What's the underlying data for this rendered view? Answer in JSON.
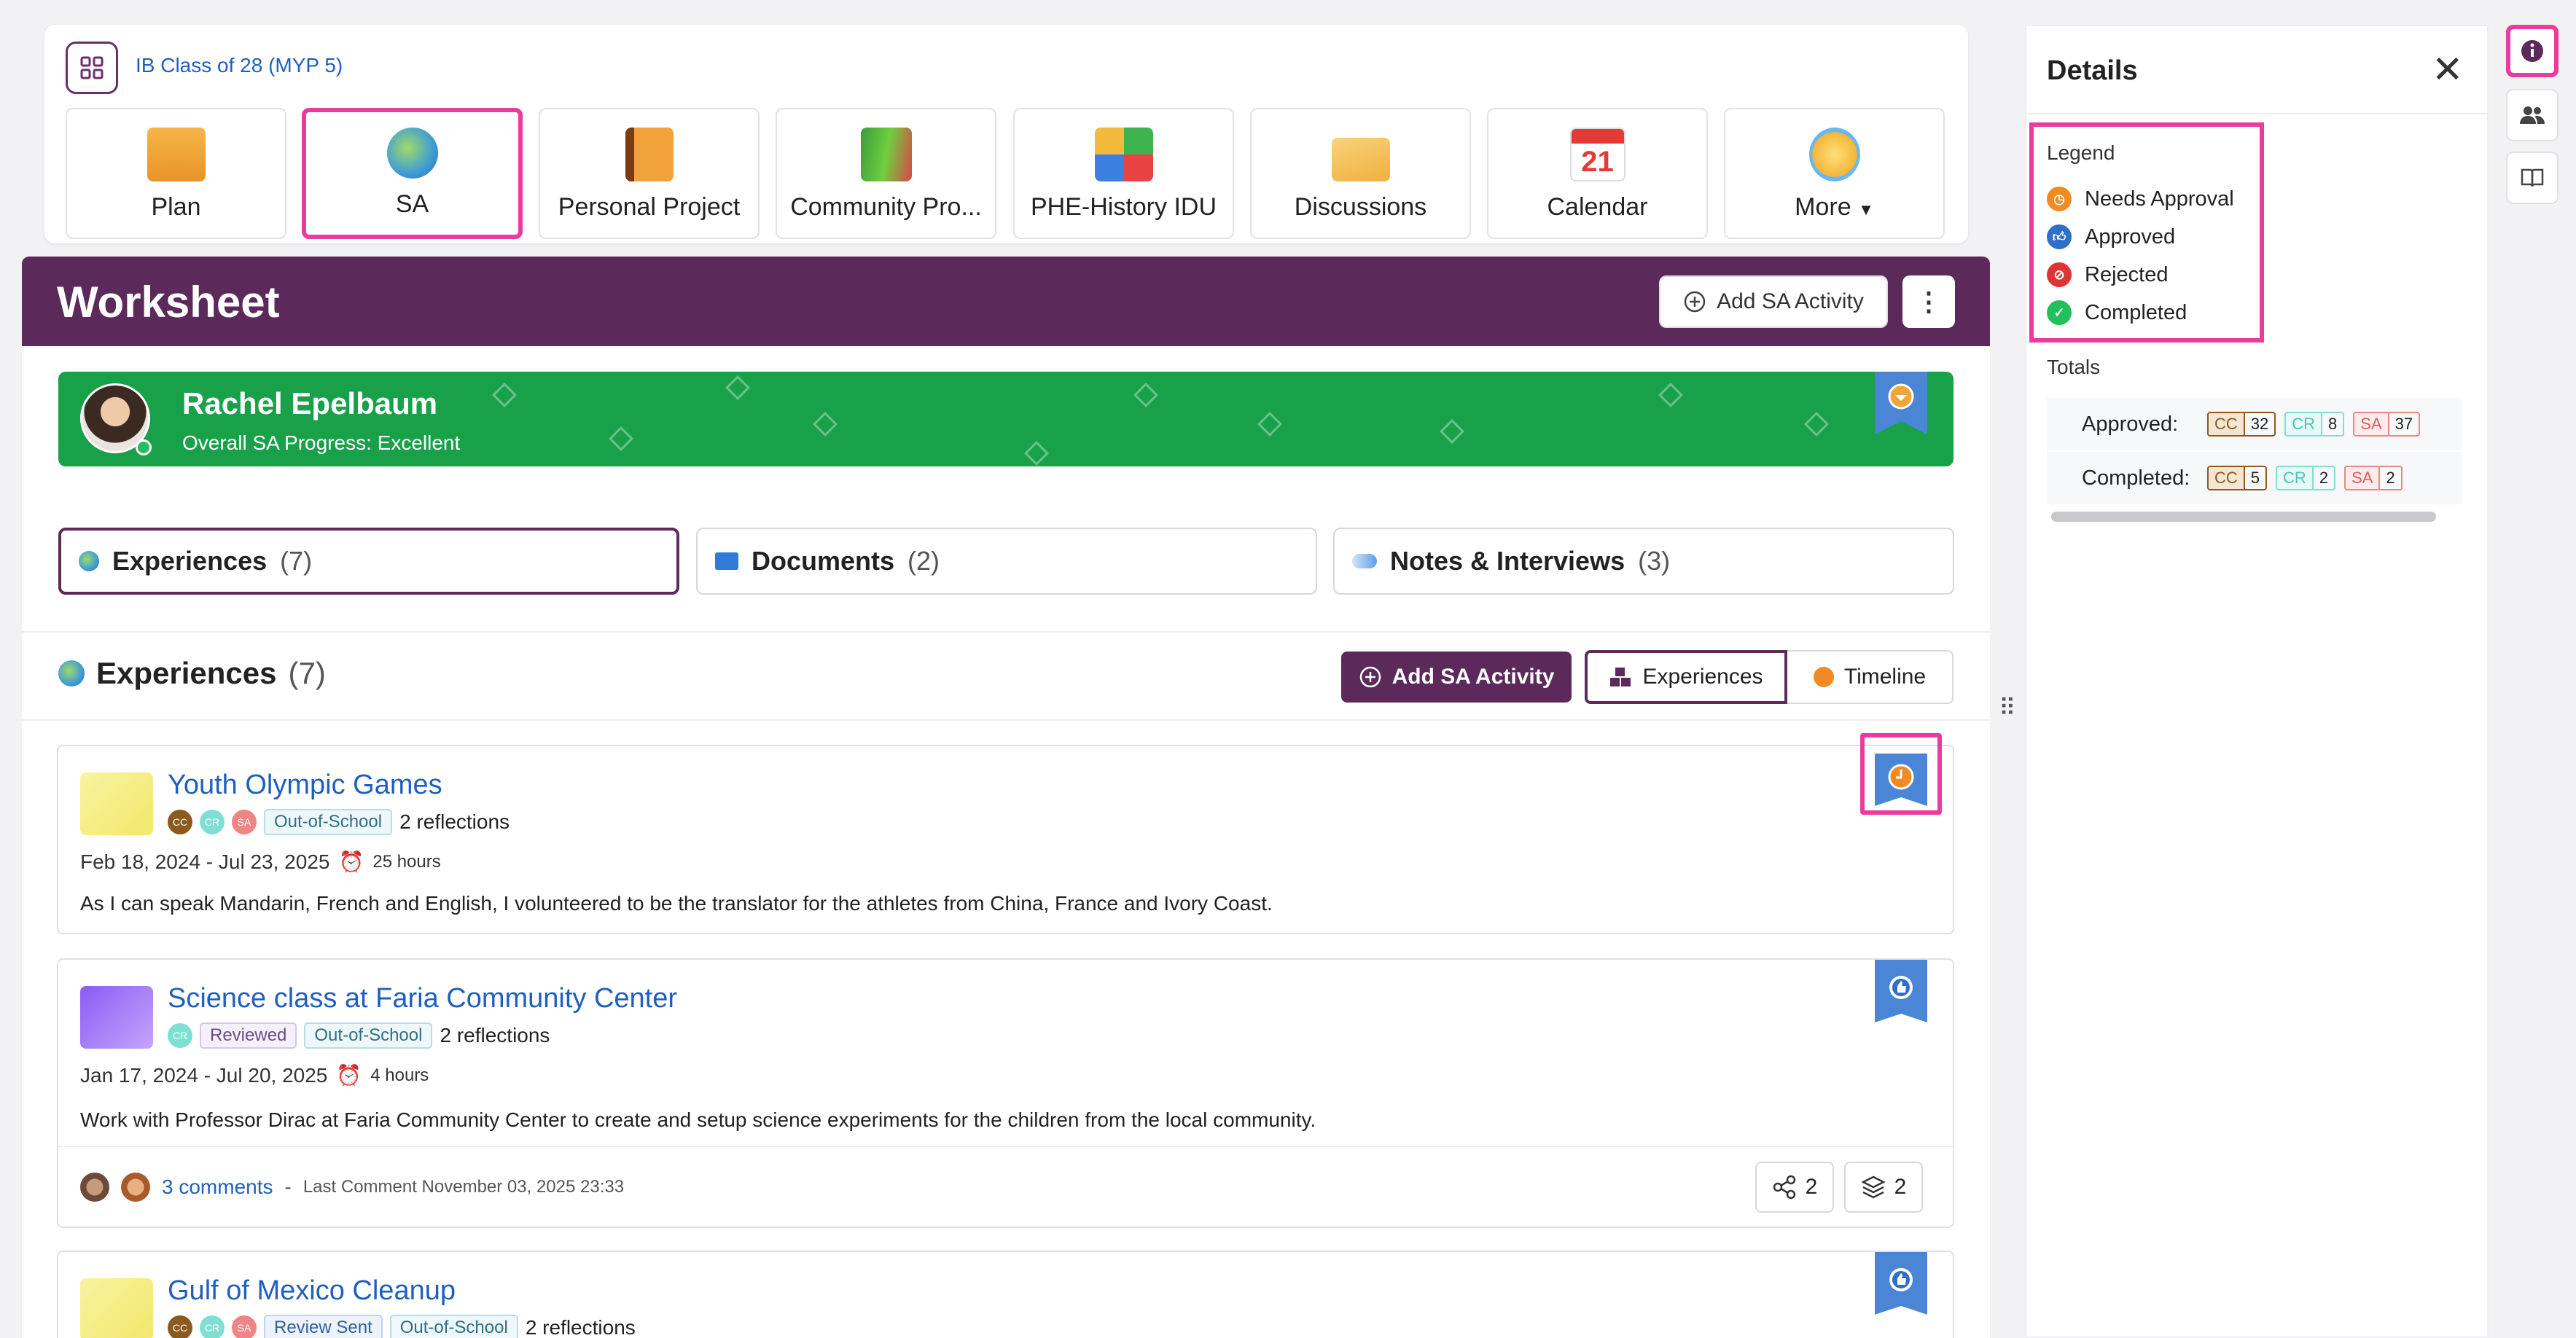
{
  "header": {
    "class_link": "IB Class of 28 (MYP 5)",
    "nav_tiles": [
      {
        "label": "Plan",
        "icon": "plan-icon",
        "selected": false
      },
      {
        "label": "SA",
        "icon": "globe-icon",
        "selected": true
      },
      {
        "label": "Personal Project",
        "icon": "notebook-icon",
        "selected": false
      },
      {
        "label": "Community Pro...",
        "icon": "books-icon",
        "selected": false
      },
      {
        "label": "PHE-History IDU",
        "icon": "puzzle-icon",
        "selected": false
      },
      {
        "label": "Discussions",
        "icon": "envelope-icon",
        "selected": false
      },
      {
        "label": "Calendar",
        "icon": "calendar-icon",
        "selected": false,
        "calendar_day": "21"
      },
      {
        "label": "More",
        "icon": "lightbulb-icon",
        "selected": false
      }
    ]
  },
  "worksheet": {
    "title": "Worksheet",
    "add_button": "Add SA Activity"
  },
  "student": {
    "name": "Rachel Epelbaum",
    "progress": "Overall SA Progress: Excellent",
    "status_color": "#19a14a"
  },
  "tabs": [
    {
      "label": "Experiences",
      "count": "(7)",
      "selected": true
    },
    {
      "label": "Documents",
      "count": "(2)",
      "selected": false
    },
    {
      "label": "Notes & Interviews",
      "count": "(3)",
      "selected": false
    }
  ],
  "section": {
    "title": "Experiences",
    "count": "(7)",
    "add_button": "Add SA Activity",
    "view_experiences": "Experiences",
    "view_timeline": "Timeline"
  },
  "experiences": [
    {
      "title": "Youth Olympic Games",
      "tags": [
        "Out-of-School"
      ],
      "reflections": "2 reflections",
      "dates": "Feb 18, 2024 - Jul 23, 2025",
      "hours": "25 hours",
      "description": "As I can speak Mandarin, French and English, I volunteered to be the translator for the athletes from China, France and Ivory Coast.",
      "status": "Needs Approval"
    },
    {
      "title": "Science class at Faria Community Center",
      "tags": [
        "Reviewed",
        "Out-of-School"
      ],
      "reflections": "2 reflections",
      "dates": "Jan 17, 2024 - Jul 20, 2025",
      "hours": "4 hours",
      "description": "Work with Professor Dirac at Faria Community Center to create and setup science experiments for the children from the local community.",
      "comments": "3 comments",
      "last_comment": "Last Comment November 03, 2025 23:33",
      "share_count": "2",
      "layers_count": "2",
      "status": "Approved"
    },
    {
      "title": "Gulf of Mexico Cleanup",
      "tags": [
        "Review Sent",
        "Out-of-School"
      ],
      "reflections": "2 reflections",
      "status": "Approved"
    }
  ],
  "details": {
    "title": "Details",
    "legend_title": "Legend",
    "legend": [
      {
        "label": "Needs Approval",
        "color": "#f08a24"
      },
      {
        "label": "Approved",
        "color": "#2f6fc9"
      },
      {
        "label": "Rejected",
        "color": "#e03434"
      },
      {
        "label": "Completed",
        "color": "#21c05a"
      }
    ],
    "totals_title": "Totals",
    "totals": [
      {
        "label": "Approved:",
        "cc": "32",
        "cr": "8",
        "sa": "37"
      },
      {
        "label": "Completed:",
        "cc": "5",
        "cr": "2",
        "sa": "2"
      }
    ],
    "badge_keys": {
      "cc": "CC",
      "cr": "CR",
      "sa": "SA"
    }
  },
  "rail": [
    "info-icon",
    "people-icon",
    "book-icon"
  ]
}
